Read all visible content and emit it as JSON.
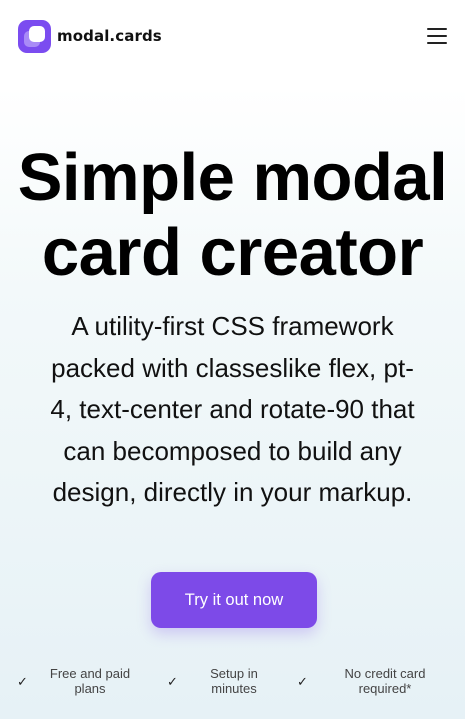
{
  "header": {
    "brand_name": "modal.cards",
    "logo_icon": "stacked-cards-icon",
    "menu_icon": "hamburger-menu-icon"
  },
  "hero": {
    "title_line1": "Simple modal",
    "title_line2": "card creator",
    "subtitle_lines": [
      "A utility-first CSS framework",
      "packed with classeslike flex, pt-",
      "4, text-center and rotate-90 that",
      "can becomposed to build any",
      "design, directly in your markup."
    ],
    "cta_label": "Try it out now"
  },
  "features": [
    {
      "icon": "check-icon",
      "line1": "Free and paid",
      "line2": "plans"
    },
    {
      "icon": "check-icon",
      "line1": "Setup in",
      "line2": "minutes"
    },
    {
      "icon": "check-icon",
      "line1": "No credit card",
      "line2": "required*"
    }
  ],
  "colors": {
    "accent": "#7d4ae8",
    "logo_primary": "#7b4cf0",
    "logo_secondary": "#a98bf7",
    "text": "#000000",
    "background_bottom": "#e6f1f6"
  }
}
